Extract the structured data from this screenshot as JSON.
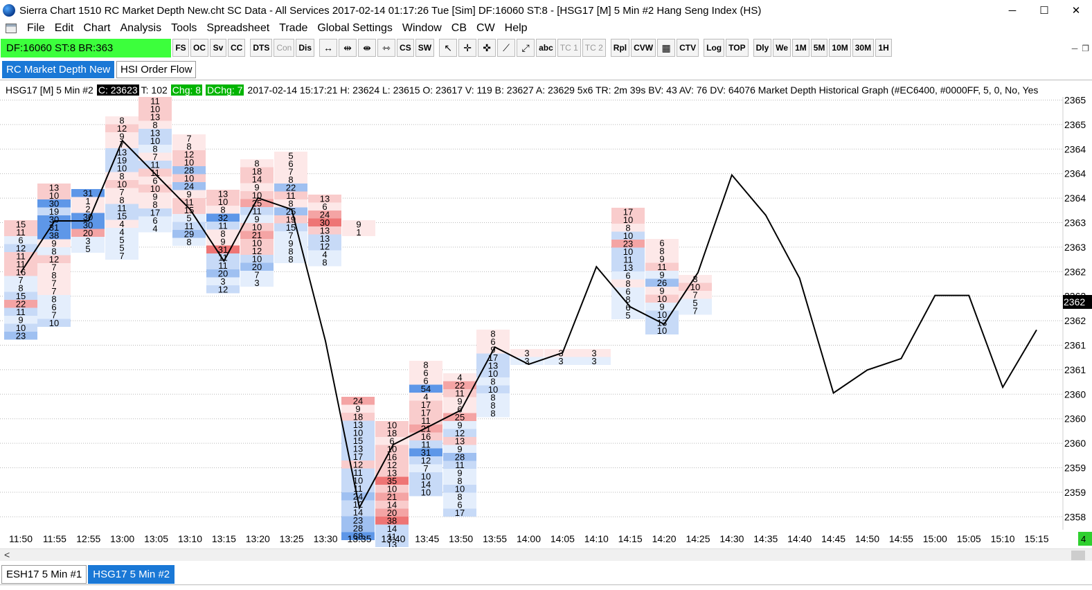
{
  "window": {
    "title": "Sierra Chart 1510 RC Market Depth New.cht  SC Data - All Services 2017-02-14  01:17:26 Tue [Sim]  DF:16060  ST:8 - [HSG17 [M]  5 Min  #2  Hang Seng Index (HS)",
    "minimize": "─",
    "maximize": "☐",
    "close": "✕"
  },
  "menu": [
    "File",
    "Edit",
    "Chart",
    "Analysis",
    "Tools",
    "Spreadsheet",
    "Trade",
    "Global Settings",
    "Window",
    "CB",
    "CW",
    "Help"
  ],
  "mdi": {
    "minimize": "─",
    "restore": "❐"
  },
  "status_box": "DF:16060  ST:8  BR:363",
  "toolbar": {
    "group1": [
      "FS",
      "OC",
      "Sv",
      "CC"
    ],
    "group2": [
      "DTS",
      "Con",
      "Dis"
    ],
    "icons": [
      "↔",
      "⇹",
      "⇼",
      "⇿"
    ],
    "group3": [
      "CS",
      "SW"
    ],
    "tools": [
      "↖",
      "✛",
      "✜",
      "⟋",
      "⤢"
    ],
    "group4": [
      "abc",
      "TC 1",
      "TC 2"
    ],
    "group5": [
      "Rpl",
      "CVW",
      "▦",
      "CTV"
    ],
    "group6": [
      "Log",
      "TOP"
    ],
    "group7": [
      "Dly",
      "We",
      "1M",
      "5M",
      "10M",
      "30M",
      "1H"
    ]
  },
  "tabs": [
    "RC Market Depth New",
    "HSI Order Flow"
  ],
  "info": {
    "symbol": "HSG17 [M]  5 Min  #2",
    "close": "C: 23623",
    "trades": "T: 102",
    "chg": "Chg: 8",
    "dchg": "DChg: 7",
    "rest": "2017-02-14 15:17:21 H: 23624 L: 23615 O: 23617 V: 119 B: 23627 A: 23629 5x6 TR: 2m 39s BV: 43 AV: 76 DV: 64076  Market Depth Historical Graph   (#EC6400, #0000FF, 5, 0, No, Yes"
  },
  "bottom_tabs": [
    "ESH17   5 Min   #1",
    "HSG17   5 Min   #2"
  ],
  "colors": {
    "status_green": "#3cff3c",
    "tab_blue": "#1a78d6",
    "bid": "#2f7fe6",
    "ask": "#e8403a",
    "price_line": "#000000"
  },
  "chart_data": {
    "type": "line",
    "title": "",
    "y_axis_labels": [
      "2365",
      "2365",
      "2364",
      "2364",
      "2364",
      "2363",
      "2363",
      "2362",
      "2362",
      "2362",
      "2361",
      "2361",
      "2360",
      "2360",
      "2360",
      "2359",
      "2359",
      "2358"
    ],
    "current_price_label": "2362",
    "right_edge_tag": "4",
    "x_axis_labels": [
      "11:50",
      "11:55",
      "12:55",
      "13:00",
      "13:05",
      "13:10",
      "13:15",
      "13:20",
      "13:25",
      "13:30",
      "13:35",
      "13:40",
      "13:45",
      "13:50",
      "13:55",
      "14:00",
      "14:05",
      "14:10",
      "14:15",
      "14:20",
      "14:25",
      "14:30",
      "14:35",
      "14:40",
      "14:45",
      "14:50",
      "14:55",
      "15:00",
      "15:05",
      "15:10",
      "15:15"
    ],
    "series": [
      {
        "values": [
          23624,
          23633,
          23633,
          23647,
          23641,
          23635,
          23626,
          23637,
          23635,
          23612,
          23583,
          23594,
          23597,
          23600,
          23611,
          23608,
          23610,
          23625,
          23618,
          23615,
          23624,
          23641,
          23634,
          23623,
          23603,
          23607,
          23609,
          23620,
          23620,
          23604,
          23614
        ]
      }
    ],
    "depth_columns": [
      {
        "cells": [
          [
            "15",
            "a"
          ],
          [
            "11",
            "a"
          ],
          [
            "6",
            "b"
          ],
          [
            "12",
            "b"
          ],
          [
            "11",
            "a"
          ],
          [
            "11",
            "a"
          ],
          [
            "16",
            "a"
          ],
          [
            "7",
            "b"
          ],
          [
            "8",
            "b"
          ],
          [
            "15",
            "b"
          ],
          [
            "22",
            "a"
          ],
          [
            "11",
            "b"
          ],
          [
            "9",
            "b"
          ],
          [
            "10",
            "b"
          ],
          [
            "23",
            "b"
          ]
        ]
      },
      {
        "cells": [
          [
            "13",
            "a"
          ],
          [
            "10",
            "a"
          ],
          [
            "30",
            "b"
          ],
          [
            "19",
            "b"
          ],
          [
            "30",
            "b"
          ],
          [
            "31",
            "b"
          ],
          [
            "38",
            "b"
          ],
          [
            "9",
            "a"
          ],
          [
            "8",
            "b"
          ],
          [
            "12",
            "a"
          ],
          [
            "7",
            "a"
          ],
          [
            "8",
            "a"
          ],
          [
            "7",
            "a"
          ],
          [
            "7",
            "a"
          ],
          [
            "8",
            "b"
          ],
          [
            "6",
            "b"
          ],
          [
            "7",
            "b"
          ],
          [
            "10",
            "b"
          ]
        ]
      },
      {
        "cells": [
          [
            "31",
            "b"
          ],
          [
            "1",
            "a"
          ],
          [
            "2",
            "a"
          ],
          [
            "30",
            "b"
          ],
          [
            "30",
            "b"
          ],
          [
            "20",
            "a"
          ],
          [
            "3",
            "b"
          ],
          [
            "5",
            "b"
          ]
        ]
      },
      {
        "cells": [
          [
            "8",
            "a"
          ],
          [
            "12",
            "a"
          ],
          [
            "9",
            "a"
          ],
          [
            "7",
            "a"
          ],
          [
            "13",
            "b"
          ],
          [
            "19",
            "b"
          ],
          [
            "10",
            "b"
          ],
          [
            "8",
            "a"
          ],
          [
            "10",
            "a"
          ],
          [
            "7",
            "a"
          ],
          [
            "8",
            "a"
          ],
          [
            "11",
            "b"
          ],
          [
            "15",
            "b"
          ],
          [
            "4",
            "a"
          ],
          [
            "4",
            "b"
          ],
          [
            "5",
            "b"
          ],
          [
            "5",
            "b"
          ],
          [
            "7",
            "b"
          ]
        ]
      },
      {
        "cells": [
          [
            "11",
            "a"
          ],
          [
            "10",
            "a"
          ],
          [
            "13",
            "a"
          ],
          [
            "8",
            "a"
          ],
          [
            "13",
            "b"
          ],
          [
            "10",
            "b"
          ],
          [
            "8",
            "b"
          ],
          [
            "7",
            "a"
          ],
          [
            "11",
            "b"
          ],
          [
            "11",
            "a"
          ],
          [
            "6",
            "a"
          ],
          [
            "10",
            "a"
          ],
          [
            "9",
            "a"
          ],
          [
            "8",
            "a"
          ],
          [
            "17",
            "b"
          ],
          [
            "6",
            "b"
          ],
          [
            "4",
            "b"
          ]
        ]
      },
      {
        "cells": [
          [
            "7",
            "a"
          ],
          [
            "8",
            "a"
          ],
          [
            "12",
            "a"
          ],
          [
            "10",
            "a"
          ],
          [
            "28",
            "b"
          ],
          [
            "10",
            "a"
          ],
          [
            "24",
            "b"
          ],
          [
            "9",
            "a"
          ],
          [
            "11",
            "a"
          ],
          [
            "15",
            "a"
          ],
          [
            "5",
            "b"
          ],
          [
            "11",
            "b"
          ],
          [
            "29",
            "b"
          ],
          [
            "8",
            "b"
          ]
        ]
      },
      {
        "cells": [
          [
            "13",
            "a"
          ],
          [
            "10",
            "a"
          ],
          [
            "8",
            "a"
          ],
          [
            "32",
            "b"
          ],
          [
            "11",
            "b"
          ],
          [
            "8",
            "a"
          ],
          [
            "9",
            "a"
          ],
          [
            "31",
            "a"
          ],
          [
            "11",
            "b"
          ],
          [
            "11",
            "b"
          ],
          [
            "20",
            "b"
          ],
          [
            "3",
            "b"
          ],
          [
            "12",
            "b"
          ]
        ]
      },
      {
        "cells": [
          [
            "8",
            "a"
          ],
          [
            "18",
            "a"
          ],
          [
            "14",
            "a"
          ],
          [
            "9",
            "a"
          ],
          [
            "10",
            "a"
          ],
          [
            "25",
            "a"
          ],
          [
            "11",
            "b"
          ],
          [
            "9",
            "b"
          ],
          [
            "10",
            "a"
          ],
          [
            "21",
            "a"
          ],
          [
            "10",
            "a"
          ],
          [
            "12",
            "a"
          ],
          [
            "10",
            "b"
          ],
          [
            "20",
            "b"
          ],
          [
            "7",
            "b"
          ],
          [
            "3",
            "b"
          ]
        ]
      },
      {
        "cells": [
          [
            "5",
            "a"
          ],
          [
            "6",
            "a"
          ],
          [
            "7",
            "a"
          ],
          [
            "8",
            "a"
          ],
          [
            "22",
            "b"
          ],
          [
            "11",
            "a"
          ],
          [
            "8",
            "a"
          ],
          [
            "25",
            "b"
          ],
          [
            "19",
            "a"
          ],
          [
            "15",
            "b"
          ],
          [
            "7",
            "b"
          ],
          [
            "9",
            "b"
          ],
          [
            "8",
            "b"
          ],
          [
            "8",
            "b"
          ]
        ]
      },
      {
        "cells": [
          [
            "13",
            "a"
          ],
          [
            "6",
            "a"
          ],
          [
            "24",
            "a"
          ],
          [
            "30",
            "a"
          ],
          [
            "13",
            "a"
          ],
          [
            "13",
            "b"
          ],
          [
            "12",
            "b"
          ],
          [
            "4",
            "b"
          ],
          [
            "8",
            "b"
          ]
        ]
      },
      {
        "cells": [
          [
            "9",
            "a"
          ],
          [
            "1",
            "a"
          ]
        ]
      },
      {
        "cells": [
          [
            "24",
            "a"
          ],
          [
            "9",
            "a"
          ],
          [
            "18",
            "a"
          ],
          [
            "13",
            "b"
          ],
          [
            "10",
            "b"
          ],
          [
            "15",
            "b"
          ],
          [
            "13",
            "b"
          ],
          [
            "17",
            "b"
          ],
          [
            "12",
            "a"
          ],
          [
            "11",
            "b"
          ],
          [
            "10",
            "b"
          ],
          [
            "11",
            "b"
          ],
          [
            "24",
            "b"
          ],
          [
            "12",
            "b"
          ],
          [
            "14",
            "b"
          ],
          [
            "23",
            "b"
          ],
          [
            "28",
            "b"
          ],
          [
            "68",
            "b"
          ]
        ]
      },
      {
        "cells": [
          [
            "10",
            "a"
          ],
          [
            "18",
            "a"
          ],
          [
            "6",
            "a"
          ],
          [
            "10",
            "a"
          ],
          [
            "16",
            "a"
          ],
          [
            "12",
            "a"
          ],
          [
            "13",
            "a"
          ],
          [
            "35",
            "a"
          ],
          [
            "10",
            "a"
          ],
          [
            "21",
            "a"
          ],
          [
            "14",
            "a"
          ],
          [
            "20",
            "a"
          ],
          [
            "38",
            "a"
          ],
          [
            "14",
            "b"
          ],
          [
            "11",
            "b"
          ],
          [
            "13",
            "b"
          ]
        ]
      },
      {
        "cells": [
          [
            "8",
            "a"
          ],
          [
            "6",
            "a"
          ],
          [
            "6",
            "a"
          ],
          [
            "54",
            "b"
          ],
          [
            "4",
            "a"
          ],
          [
            "17",
            "a"
          ],
          [
            "17",
            "a"
          ],
          [
            "11",
            "a"
          ],
          [
            "21",
            "a"
          ],
          [
            "16",
            "a"
          ],
          [
            "11",
            "b"
          ],
          [
            "31",
            "b"
          ],
          [
            "12",
            "b"
          ],
          [
            "7",
            "b"
          ],
          [
            "10",
            "b"
          ],
          [
            "14",
            "b"
          ],
          [
            "10",
            "b"
          ]
        ]
      },
      {
        "cells": [
          [
            "4",
            "a"
          ],
          [
            "22",
            "a"
          ],
          [
            "11",
            "a"
          ],
          [
            "9",
            "a"
          ],
          [
            "6",
            "a"
          ],
          [
            "25",
            "a"
          ],
          [
            "9",
            "b"
          ],
          [
            "12",
            "b"
          ],
          [
            "13",
            "a"
          ],
          [
            "9",
            "b"
          ],
          [
            "28",
            "b"
          ],
          [
            "11",
            "b"
          ],
          [
            "9",
            "b"
          ],
          [
            "8",
            "b"
          ],
          [
            "10",
            "b"
          ],
          [
            "8",
            "b"
          ],
          [
            "6",
            "b"
          ],
          [
            "17",
            "b"
          ]
        ]
      },
      {
        "cells": [
          [
            "8",
            "a"
          ],
          [
            "6",
            "a"
          ],
          [
            "9",
            "a"
          ],
          [
            "17",
            "b"
          ],
          [
            "13",
            "b"
          ],
          [
            "10",
            "b"
          ],
          [
            "8",
            "b"
          ],
          [
            "10",
            "b"
          ],
          [
            "8",
            "b"
          ],
          [
            "8",
            "b"
          ],
          [
            "8",
            "b"
          ]
        ]
      },
      {
        "cells": [
          [
            "3",
            "a"
          ],
          [
            "3",
            "b"
          ]
        ]
      },
      {
        "cells": [
          [
            "3",
            "a"
          ],
          [
            "3",
            "b"
          ]
        ]
      },
      {
        "cells": [
          [
            "3",
            "a"
          ],
          [
            "3",
            "b"
          ]
        ]
      },
      {
        "cells": [
          [
            "17",
            "a"
          ],
          [
            "10",
            "a"
          ],
          [
            "8",
            "a"
          ],
          [
            "10",
            "b"
          ],
          [
            "23",
            "a"
          ],
          [
            "10",
            "b"
          ],
          [
            "11",
            "b"
          ],
          [
            "13",
            "b"
          ],
          [
            "6",
            "b"
          ],
          [
            "8",
            "a"
          ],
          [
            "6",
            "b"
          ],
          [
            "8",
            "b"
          ],
          [
            "6",
            "b"
          ],
          [
            "5",
            "b"
          ]
        ]
      },
      {
        "cells": [
          [
            "6",
            "a"
          ],
          [
            "8",
            "a"
          ],
          [
            "9",
            "a"
          ],
          [
            "11",
            "a"
          ],
          [
            "9",
            "b"
          ],
          [
            "26",
            "b"
          ],
          [
            "9",
            "a"
          ],
          [
            "10",
            "a"
          ],
          [
            "9",
            "b"
          ],
          [
            "10",
            "b"
          ],
          [
            "13",
            "b"
          ],
          [
            "10",
            "b"
          ]
        ]
      },
      {
        "cells": [
          [
            "3",
            "a"
          ],
          [
            "10",
            "a"
          ],
          [
            "7",
            "a"
          ],
          [
            "5",
            "b"
          ],
          [
            "7",
            "b"
          ]
        ]
      }
    ]
  }
}
